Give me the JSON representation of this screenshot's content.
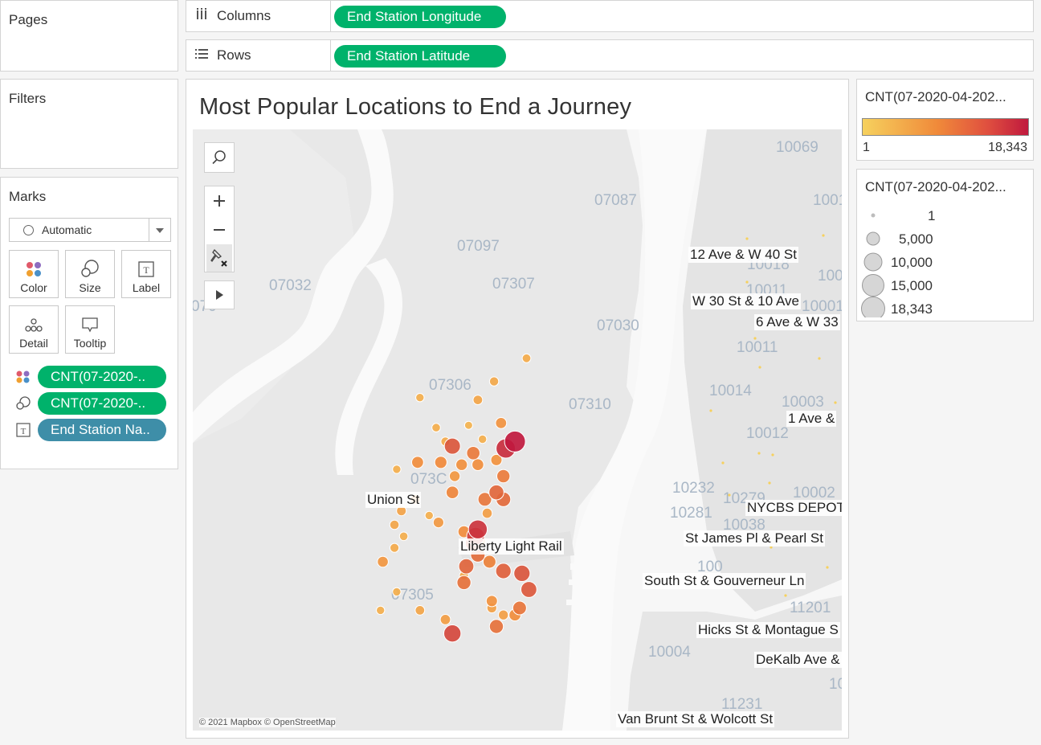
{
  "pages": {
    "title": "Pages"
  },
  "filters": {
    "title": "Filters"
  },
  "marks": {
    "title": "Marks",
    "type_select": "Automatic",
    "buttons": [
      "Color",
      "Size",
      "Label",
      "Detail",
      "Tooltip"
    ],
    "fields": [
      "CNT(07-2020-..",
      "CNT(07-2020-..",
      "End Station Na.."
    ]
  },
  "shelves": {
    "columns_label": "Columns",
    "columns_pill": "End Station Longitude",
    "rows_label": "Rows",
    "rows_pill": "End Station Latitude"
  },
  "view": {
    "title": "Most Popular Locations to End a Journey",
    "attribution": "© 2021 Mapbox © OpenStreetMap"
  },
  "colors": {
    "accent_green": "#00b26b",
    "pill_blue": "#3e8ea8",
    "scale_low": "#f6d15e",
    "scale_mid": "#f08a3a",
    "scale_high": "#c0193e"
  },
  "color_legend": {
    "title": "CNT(07-2020-04-202...",
    "min": "1",
    "max": "18,343"
  },
  "size_legend": {
    "title": "CNT(07-2020-04-202...",
    "items": [
      "1",
      "5,000",
      "10,000",
      "15,000",
      "18,343"
    ]
  },
  "map": {
    "zip_labels": [
      "10069",
      "07087",
      "1001",
      "07097",
      "07307",
      "07032",
      "070",
      "07030",
      "10011",
      "07306",
      "07310",
      "10014",
      "10003",
      "10012",
      "073C",
      "10232",
      "10281",
      "10279",
      "10002",
      "10038",
      "10011",
      "07305",
      "11201",
      "10004",
      "11231",
      "10018",
      "10001",
      "10016",
      "100",
      "10"
    ],
    "station_labels": [
      "12 Ave & W 40 St",
      "W 30 St & 10 Ave",
      "6 Ave & W 33",
      "1 Ave &",
      "Union St",
      "Liberty Light Rail",
      "NYCBS DEPOT",
      "St James Pl & Pearl St",
      "South St & Gouverneur Ln",
      "Hicks St & Montague S",
      "DeKalb Ave &",
      "Van Brunt St & Wolcott St"
    ],
    "stations": [
      {
        "lon": -74.0455,
        "lat": 40.7175,
        "count": 1200
      },
      {
        "lon": -74.0385,
        "lat": 40.7265,
        "count": 1500
      },
      {
        "lon": -74.028,
        "lat": 40.7355,
        "count": 1100
      },
      {
        "lon": -74.051,
        "lat": 40.727,
        "count": 900
      },
      {
        "lon": -74.0475,
        "lat": 40.7205,
        "count": 1000
      },
      {
        "lon": -74.035,
        "lat": 40.7305,
        "count": 1300
      },
      {
        "lon": -74.0335,
        "lat": 40.7215,
        "count": 2800
      },
      {
        "lon": -74.0375,
        "lat": 40.718,
        "count": 900
      },
      {
        "lon": -74.0405,
        "lat": 40.721,
        "count": 700
      },
      {
        "lon": -74.044,
        "lat": 40.7165,
        "count": 9000
      },
      {
        "lon": -74.0515,
        "lat": 40.713,
        "count": 3500
      },
      {
        "lon": -74.0465,
        "lat": 40.713,
        "count": 3800
      },
      {
        "lon": -74.042,
        "lat": 40.7125,
        "count": 3200
      },
      {
        "lon": -74.0435,
        "lat": 40.71,
        "count": 2500
      },
      {
        "lon": -74.044,
        "lat": 40.7065,
        "count": 4200
      },
      {
        "lon": -74.052,
        "lat": 40.705,
        "count": 1800
      },
      {
        "lon": -74.055,
        "lat": 40.7025,
        "count": 1600
      },
      {
        "lon": -74.047,
        "lat": 40.7,
        "count": 2400
      },
      {
        "lon": -74.0415,
        "lat": 40.698,
        "count": 3600
      },
      {
        "lon": -74.038,
        "lat": 40.696,
        "count": 2200
      },
      {
        "lon": -74.0365,
        "lat": 40.702,
        "count": 2000
      },
      {
        "lon": -74.039,
        "lat": 40.697,
        "count": 12000
      },
      {
        "lon": -74.0325,
        "lat": 40.716,
        "count": 15000
      },
      {
        "lon": -74.0305,
        "lat": 40.7175,
        "count": 18343
      },
      {
        "lon": -74.0345,
        "lat": 40.7135,
        "count": 3000
      },
      {
        "lon": -74.0395,
        "lat": 40.715,
        "count": 5200
      },
      {
        "lon": -74.0385,
        "lat": 40.7125,
        "count": 3400
      },
      {
        "lon": -74.033,
        "lat": 40.71,
        "count": 5000
      },
      {
        "lon": -74.0345,
        "lat": 40.7065,
        "count": 7200
      },
      {
        "lon": -74.037,
        "lat": 40.705,
        "count": 5500
      },
      {
        "lon": -74.033,
        "lat": 40.705,
        "count": 6800
      },
      {
        "lon": -74.0385,
        "lat": 40.6985,
        "count": 14000
      },
      {
        "lon": -74.0395,
        "lat": 40.6955,
        "count": 8500
      },
      {
        "lon": -74.0385,
        "lat": 40.693,
        "count": 6500
      },
      {
        "lon": -74.041,
        "lat": 40.6905,
        "count": 7400
      },
      {
        "lon": -74.0415,
        "lat": 40.687,
        "count": 6000
      },
      {
        "lon": -74.036,
        "lat": 40.6915,
        "count": 4500
      },
      {
        "lon": -74.033,
        "lat": 40.6895,
        "count": 8000
      },
      {
        "lon": -74.029,
        "lat": 40.689,
        "count": 9200
      },
      {
        "lon": -74.0275,
        "lat": 40.6855,
        "count": 8800
      },
      {
        "lon": -74.0295,
        "lat": 40.6815,
        "count": 5600
      },
      {
        "lon": -74.0355,
        "lat": 40.683,
        "count": 3000
      },
      {
        "lon": -74.0355,
        "lat": 40.6815,
        "count": 1800
      },
      {
        "lon": -74.033,
        "lat": 40.68,
        "count": 1900
      },
      {
        "lon": -74.0305,
        "lat": 40.68,
        "count": 3500
      },
      {
        "lon": -74.0345,
        "lat": 40.6775,
        "count": 6000
      },
      {
        "lon": -74.044,
        "lat": 40.676,
        "count": 11000
      },
      {
        "lon": -74.051,
        "lat": 40.681,
        "count": 1500
      },
      {
        "lon": -74.0455,
        "lat": 40.679,
        "count": 2100
      },
      {
        "lon": -74.0595,
        "lat": 40.681,
        "count": 900
      },
      {
        "lon": -74.0565,
        "lat": 40.6945,
        "count": 1200
      },
      {
        "lon": -74.0565,
        "lat": 40.6995,
        "count": 1400
      },
      {
        "lon": -74.0545,
        "lat": 40.697,
        "count": 1000
      },
      {
        "lon": -74.059,
        "lat": 40.6915,
        "count": 2600
      },
      {
        "lon": -74.049,
        "lat": 40.7015,
        "count": 900
      },
      {
        "lon": -74.0415,
        "lat": 40.6885,
        "count": 1200
      },
      {
        "lon": -74.056,
        "lat": 40.685,
        "count": 900
      },
      {
        "lon": -74.056,
        "lat": 40.7115,
        "count": 900
      }
    ]
  }
}
